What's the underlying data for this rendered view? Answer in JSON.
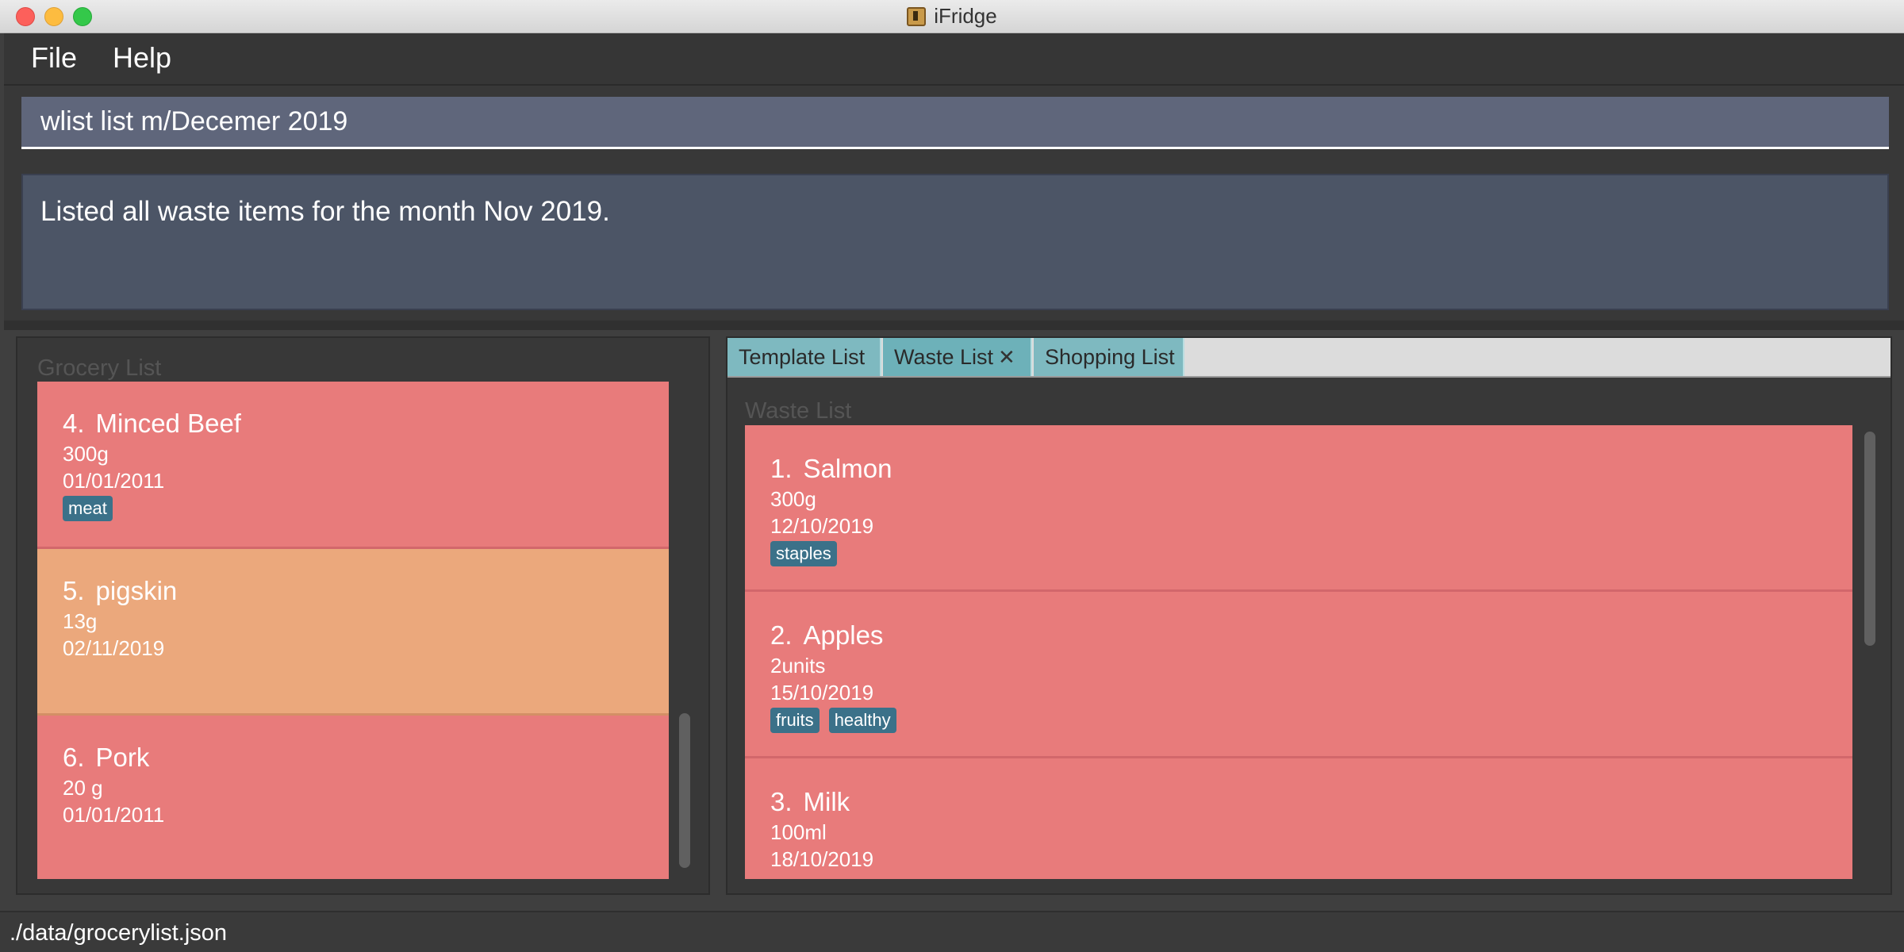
{
  "window": {
    "title": "iFridge",
    "icon": "fridge-app-icon"
  },
  "menu": {
    "file": "File",
    "help": "Help"
  },
  "command": {
    "value": "wlist list m/Decemer 2019"
  },
  "result": {
    "message": "Listed all waste items for the month Nov 2019."
  },
  "grocery": {
    "title": "Grocery List",
    "items": [
      {
        "index": "4.",
        "name": "Minced Beef",
        "amount": "300g",
        "date": "01/01/2011",
        "tags": [
          "meat"
        ],
        "color": "#e87b7b"
      },
      {
        "index": "5.",
        "name": "pigskin",
        "amount": "13g",
        "date": "02/11/2019",
        "tags": [],
        "color": "#eba87c"
      },
      {
        "index": "6.",
        "name": "Pork",
        "amount": "20 g",
        "date": "01/01/2011",
        "tags": [],
        "color": "#e87b7b"
      }
    ]
  },
  "tabs": [
    {
      "label": "Template List",
      "closable": false
    },
    {
      "label": "Waste List",
      "closable": true
    },
    {
      "label": "Shopping List",
      "closable": false
    }
  ],
  "tab_close_glyph": "✕",
  "waste": {
    "title": "Waste List",
    "items": [
      {
        "index": "1.",
        "name": "Salmon",
        "amount": "300g",
        "date": "12/10/2019",
        "tags": [
          "staples"
        ]
      },
      {
        "index": "2.",
        "name": "Apples",
        "amount": "2units",
        "date": "15/10/2019",
        "tags": [
          "fruits",
          "healthy"
        ]
      },
      {
        "index": "3.",
        "name": "Milk",
        "amount": "100ml",
        "date": "18/10/2019",
        "tags": []
      }
    ]
  },
  "status": {
    "path": "./data/grocerylist.json"
  },
  "colors": {
    "card_red": "#e87b7b",
    "card_orange": "#eba87c",
    "tag": "#3b7189",
    "tab": "#7eb9c0",
    "command_box": "#5f667b",
    "result_box": "#4c5566"
  }
}
